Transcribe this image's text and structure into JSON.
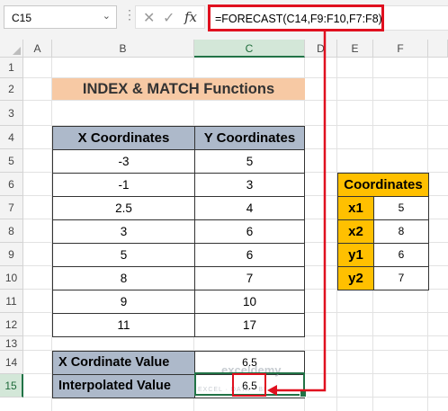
{
  "formula_bar": {
    "name_box": "C15",
    "dots": "⋮",
    "cancel": "✕",
    "enter": "✓",
    "fx": "fx",
    "formula": "=FORECAST(C14,F9:F10,F7:F8)"
  },
  "columns": [
    "A",
    "B",
    "C",
    "D",
    "E",
    "F"
  ],
  "rows": [
    "1",
    "2",
    "3",
    "4",
    "5",
    "6",
    "7",
    "8",
    "9",
    "10",
    "11",
    "12",
    "13",
    "14",
    "15"
  ],
  "title": "INDEX & MATCH Functions",
  "main_table": {
    "headers": [
      "X Coordinates",
      "Y Coordinates"
    ],
    "rows": [
      [
        "-3",
        "5"
      ],
      [
        "-1",
        "3"
      ],
      [
        "2.5",
        "4"
      ],
      [
        "3",
        "6"
      ],
      [
        "5",
        "6"
      ],
      [
        "8",
        "7"
      ],
      [
        "9",
        "10"
      ],
      [
        "11",
        "17"
      ]
    ]
  },
  "coordinates": {
    "header": "Coordinates",
    "rows": [
      [
        "x1",
        "5"
      ],
      [
        "x2",
        "8"
      ],
      [
        "y1",
        "6"
      ],
      [
        "y2",
        "7"
      ]
    ]
  },
  "results": {
    "x_label": "X Cordinate Value",
    "x_value": "6.5",
    "interp_label": "Interpolated Value",
    "interp_value": "6.5"
  },
  "watermark": {
    "name": "exceldemy",
    "tagline": "EXCEL · DATA · BI"
  },
  "colors": {
    "highlight_red": "#e0101f",
    "table_header": "#adb9ca",
    "coord_header": "#ffc000",
    "title_fill": "#f7c9a4",
    "active_green": "#217346"
  }
}
